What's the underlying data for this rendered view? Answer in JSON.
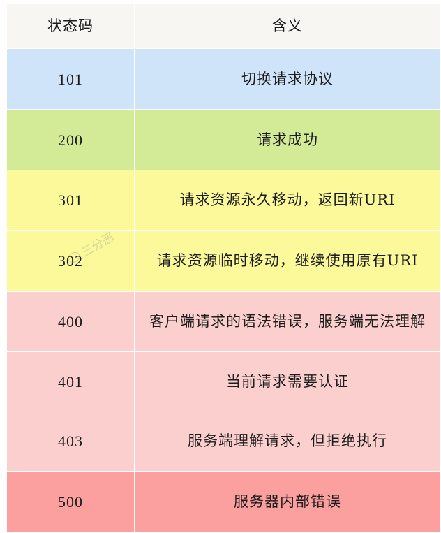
{
  "table": {
    "headers": {
      "code": "状态码",
      "meaning": "含义"
    },
    "rows": [
      {
        "code": "101",
        "meaning": "切换请求协议"
      },
      {
        "code": "200",
        "meaning": "请求成功"
      },
      {
        "code": "301",
        "meaning": "请求资源永久移动，返回新URI"
      },
      {
        "code": "302",
        "meaning": "请求资源临时移动，继续使用原有URI"
      },
      {
        "code": "400",
        "meaning": "客户端请求的语法错误，服务端无法理解"
      },
      {
        "code": "401",
        "meaning": "当前请求需要认证"
      },
      {
        "code": "403",
        "meaning": "服务端理解请求，但拒绝执行"
      },
      {
        "code": "500",
        "meaning": "服务器内部错误"
      }
    ],
    "row_colors": {
      "header": "#f7f6f3",
      "info": "#cfe4f9",
      "success": "#d3eb96",
      "redirect": "#fbf99a",
      "client_error": "#fccfcf",
      "server_error": "#fb9f9f"
    }
  },
  "watermark": {
    "text": "三分恶",
    "icon": "wechat-icon"
  }
}
